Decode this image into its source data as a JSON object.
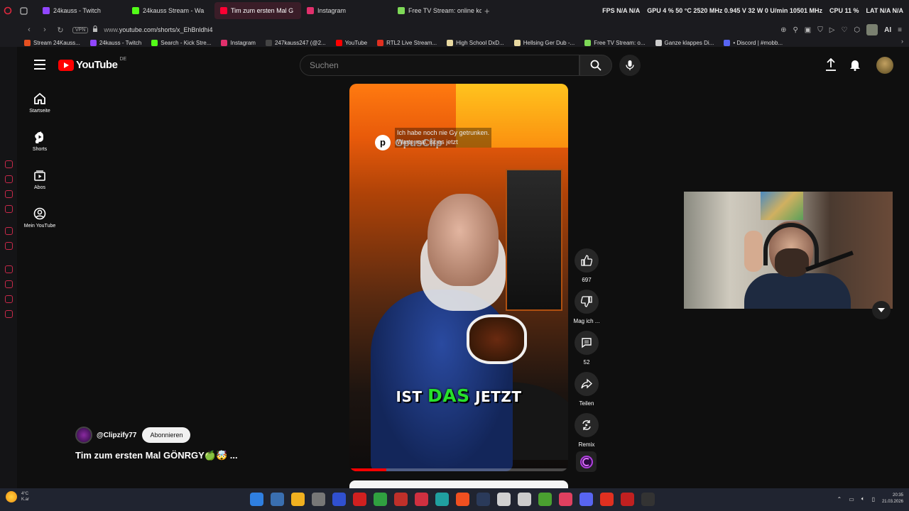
{
  "browser": {
    "tabs": [
      {
        "label": "24kauss - Twitch",
        "color": "#9146ff"
      },
      {
        "label": "24kauss Stream - Wa",
        "color": "#53fc18"
      },
      {
        "label": "Tim zum ersten Mal G",
        "color": "#ff0033"
      },
      {
        "label": "Instagram",
        "color": "#e1306c"
      },
      {
        "label": "Free TV Stream: online ko",
        "color": "#7ed957"
      }
    ],
    "active_tab_index": 2,
    "new_tab": "+",
    "hud": [
      "FPS  N/A  N/A",
      "GPU  4 %  50 °C  2520 MHz  0.945 V  32 W  0 U/min  10501 MHz",
      "CPU  11 %",
      "LAT  N/A  N/A"
    ],
    "url_prefix": "www.",
    "url_main": "youtube.com/shorts/x_EhBnldhi4",
    "vpn": "VPN",
    "ai_label": "AI",
    "bookmarks": [
      {
        "label": "Stream 24Kauss...",
        "color": "#e55020"
      },
      {
        "label": "24kauss - Twitch",
        "color": "#9146ff"
      },
      {
        "label": "Search - Kick Stre...",
        "color": "#53fc18"
      },
      {
        "label": "Instagram",
        "color": "#e1306c"
      },
      {
        "label": "247kauss247 (@2...",
        "color": "#222222"
      },
      {
        "label": "YouTube",
        "color": "#ff0000"
      },
      {
        "label": "RTL2 Live Stream...",
        "color": "#e03020"
      },
      {
        "label": "High School DxD...",
        "color": "#e8d8a0"
      },
      {
        "label": "Hellsing Ger Dub -...",
        "color": "#e8d8a0"
      },
      {
        "label": "Free TV Stream: o...",
        "color": "#7ed957"
      },
      {
        "label": "Ganze klappes Di...",
        "color": "#cccccc"
      },
      {
        "label": "• Discord | #mobb...",
        "color": "#5865f2"
      }
    ]
  },
  "youtube": {
    "region": "DE",
    "logo_text": "YouTube",
    "search_placeholder": "Suchen",
    "nav": [
      {
        "label": "Startseite",
        "icon": "home-icon"
      },
      {
        "label": "Shorts",
        "icon": "shorts-icon"
      },
      {
        "label": "Abos",
        "icon": "subscriptions-icon"
      },
      {
        "label": "Mein YouTube",
        "icon": "account-icon"
      }
    ],
    "short": {
      "overlay_logo": "OpusClip",
      "overlay_caption_line1": "Ich habe noch nie Gy getrunken.",
      "overlay_caption_line2": "Warte mal, ist es jetzt",
      "subtitle_pre": "IST",
      "subtitle_highlight": "DAS",
      "subtitle_post": "JETZT",
      "progress": 0.17
    },
    "actions": [
      {
        "label": "697",
        "icon": "like-icon"
      },
      {
        "label": "Mag ich ...",
        "icon": "dislike-icon"
      },
      {
        "label": "52",
        "icon": "comment-icon"
      },
      {
        "label": "Teilen",
        "icon": "share-icon"
      },
      {
        "label": "Remix",
        "icon": "remix-icon"
      }
    ],
    "channel": "@Clipzify77",
    "subscribe": "Abonnieren",
    "title": "Tim zum ersten Mal GÖNRGY🍏🤯 ..."
  },
  "taskbar": {
    "weather_temp": "4°C",
    "weather_desc": "K.ar",
    "time": "20:35",
    "date": "21.03.2026",
    "icon_colors": [
      "#2f7fe0",
      "#3a6fb0",
      "#f0b020",
      "#777777",
      "#3050d0",
      "#d02020",
      "#30a040",
      "#c0302a",
      "#d03040",
      "#20a0a0",
      "#f05020",
      "#2a3a5a",
      "#d0d0d0",
      "#cccccc",
      "#4aa030",
      "#e04060",
      "#5865f2",
      "#e03020",
      "#c02020",
      "#333333"
    ]
  }
}
